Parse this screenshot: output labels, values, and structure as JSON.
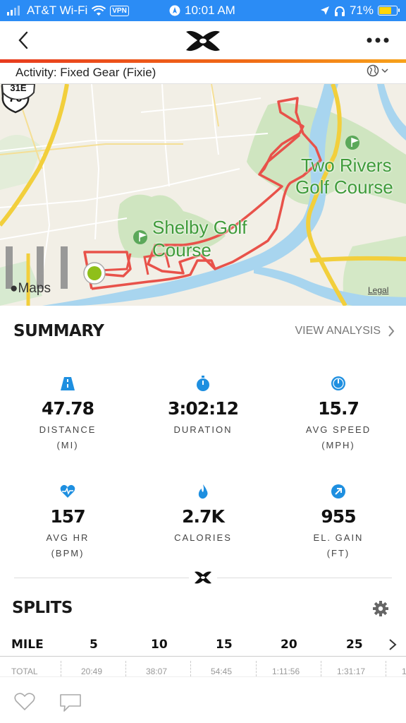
{
  "status_bar": {
    "carrier": "AT&T Wi-Fi",
    "vpn": "VPN",
    "time": "10:01 AM",
    "battery": "71%",
    "battery_level": 0.71
  },
  "activity": {
    "label": "Activity: Fixed Gear (Fixie)"
  },
  "map": {
    "place_labels": [
      "Shelby Golf",
      "Course",
      "Two Rivers",
      "Golf Course"
    ],
    "highway_number": "70",
    "highway_top": "31E",
    "attribution": "Maps",
    "legal": "Legal"
  },
  "summary": {
    "title": "SUMMARY",
    "view_analysis": "VIEW ANALYSIS",
    "stats": [
      {
        "value": "47.78",
        "label": "DISTANCE",
        "unit": "(MI)",
        "icon": "road-icon"
      },
      {
        "value": "3:02:12",
        "label": "DURATION",
        "unit": "",
        "icon": "stopwatch-icon"
      },
      {
        "value": "15.7",
        "label": "AVG SPEED",
        "unit": "(MPH)",
        "icon": "speedometer-icon"
      },
      {
        "value": "157",
        "label": "AVG HR",
        "unit": "(BPM)",
        "icon": "heart-rate-icon"
      },
      {
        "value": "2.7K",
        "label": "CALORIES",
        "unit": "",
        "icon": "flame-icon"
      },
      {
        "value": "955",
        "label": "EL. GAIN",
        "unit": "(FT)",
        "icon": "elevation-arrow-icon"
      }
    ]
  },
  "splits": {
    "title": "SPLITS",
    "header": [
      "MILE",
      "5",
      "10",
      "15",
      "20",
      "25"
    ],
    "total_label": "TOTAL",
    "total_values": [
      "20:49",
      "38:07",
      "54:45",
      "1:11:56",
      "1:31:17",
      "1"
    ]
  },
  "colors": {
    "accent_blue": "#1e8fe0",
    "route_red": "#e8524a",
    "brand_orange": "#f06a16"
  }
}
